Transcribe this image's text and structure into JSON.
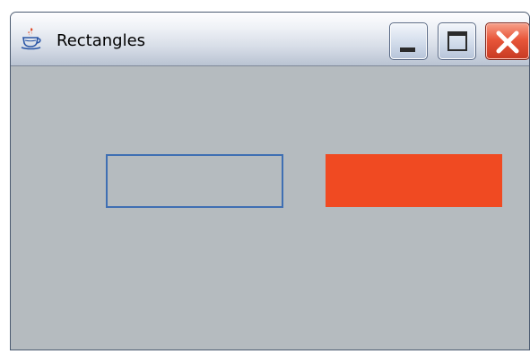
{
  "window": {
    "title": "Rectangles",
    "app_icon": "java-cup-icon",
    "controls": {
      "minimize": "minimize-icon",
      "maximize": "maximize-icon",
      "close": "close-icon"
    }
  },
  "canvas": {
    "background_color": "#b5bbbf",
    "shapes": [
      {
        "kind": "outlined-rectangle",
        "stroke_color": "#3f6fb3"
      },
      {
        "kind": "filled-rectangle",
        "fill_color": "#f04a22"
      }
    ]
  }
}
